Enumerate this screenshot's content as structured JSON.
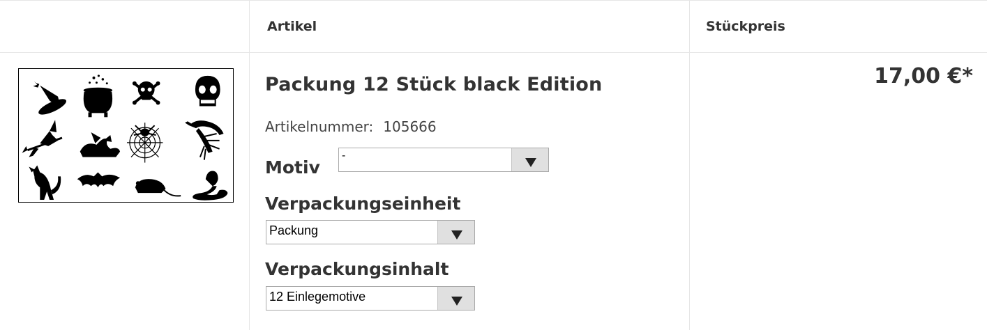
{
  "header": {
    "article_label": "Artikel",
    "unit_price_label": "Stückpreis"
  },
  "product": {
    "image_icons": [
      "witch-hat-icon",
      "cauldron-icon",
      "skull-crossbones-icon",
      "skull-icon",
      "witch-on-broom-icon",
      "dragon-icon",
      "spider-web-icon",
      "scorpion-icon",
      "black-cat-icon",
      "bat-icon",
      "rat-icon",
      "cobra-icon"
    ],
    "title": "Packung 12 Stück black Edition",
    "article_number_label": "Artikelnummer:",
    "article_number": "105666",
    "price": "17,00 €*"
  },
  "options": {
    "motiv": {
      "label": "Motiv",
      "selected": "-"
    },
    "verpackungseinheit": {
      "label": "Verpackungseinheit",
      "selected": "Packung"
    },
    "verpackungsinhalt": {
      "label": "Verpackungsinhalt",
      "selected": "12 Einlegemotive"
    }
  },
  "colors": {
    "text": "#333333",
    "grid": "#e6e6e6",
    "select_arrow_bg": "#e0e0e0"
  }
}
